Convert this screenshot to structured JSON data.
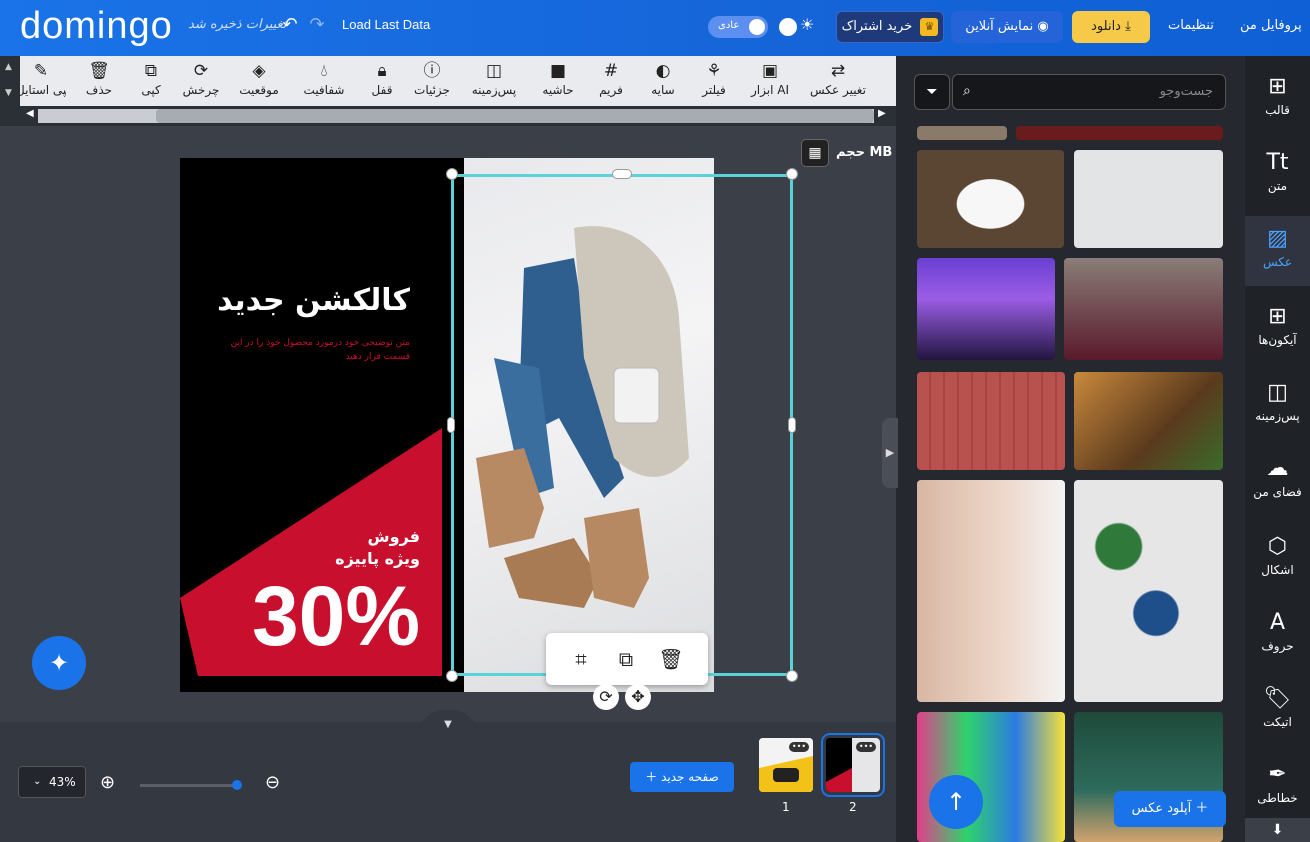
{
  "header": {
    "logo": "domingo",
    "save_note": "تغییرات ذخیره شد",
    "load_last": "Load Last Data",
    "mode_label": "عادی",
    "subscribe": "خرید اشتراک",
    "preview": "نمایش آنلاین",
    "download": "دانلود",
    "settings": "تنظیمات",
    "profile": "پروفایل من"
  },
  "toolbar": {
    "items": [
      {
        "label": "تغییر عکس",
        "icon": "swap-icon"
      },
      {
        "label": "ابزار AI",
        "icon": "ai-icon"
      },
      {
        "label": "فیلتر",
        "icon": "filter-icon"
      },
      {
        "label": "سایه",
        "icon": "shadow-icon"
      },
      {
        "label": "فریم",
        "icon": "frame-icon"
      },
      {
        "label": "حاشیه",
        "icon": "border-icon"
      },
      {
        "label": "پس‌زمینه",
        "icon": "background-icon"
      },
      {
        "label": "جزئیات",
        "icon": "info-icon"
      },
      {
        "label": "قفل",
        "icon": "lock-icon"
      },
      {
        "label": "شفافیت",
        "icon": "opacity-icon"
      },
      {
        "label": "موقعیت",
        "icon": "layers-icon"
      },
      {
        "label": "چرخش",
        "icon": "rotate-icon"
      },
      {
        "label": "کپی",
        "icon": "copy-icon"
      },
      {
        "label": "حذف",
        "icon": "trash-icon"
      },
      {
        "label": "کپی استایل",
        "icon": "brush-icon"
      }
    ]
  },
  "canvas": {
    "size_label": "حجم MB",
    "design": {
      "headline": "کالکشن جدید",
      "subtext": "متن توضیحی خود درمورد محصول خود را در این قسمت قرار دهید",
      "sale_line1": "فروش",
      "sale_line2": "ویژه پاییزه",
      "percent": "30%"
    }
  },
  "bottom": {
    "zoom": "43%",
    "new_page": "صفحه جدید",
    "pages": [
      "1",
      "2"
    ]
  },
  "panel": {
    "search_placeholder": "جست‌وجو",
    "upload": "آپلود عکس"
  },
  "sidenav": {
    "items": [
      {
        "label": "قالب",
        "icon": "template-icon"
      },
      {
        "label": "متن",
        "icon": "text-icon"
      },
      {
        "label": "عکس",
        "icon": "image-icon"
      },
      {
        "label": "آیکون‌ها",
        "icon": "grid-icon"
      },
      {
        "label": "پس‌زمینه",
        "icon": "background-icon"
      },
      {
        "label": "فضای من",
        "icon": "cloud-upload-icon"
      },
      {
        "label": "اشکال",
        "icon": "shapes-icon"
      },
      {
        "label": "حروف",
        "icon": "font-icon"
      },
      {
        "label": "اتیکت",
        "icon": "tag-icon"
      },
      {
        "label": "خطاطی",
        "icon": "feather-icon"
      }
    ]
  },
  "colors": {
    "brand": "#1a73e8",
    "accent_red": "#c8102e",
    "selection": "#5bd2d8",
    "download": "#f7c948"
  }
}
